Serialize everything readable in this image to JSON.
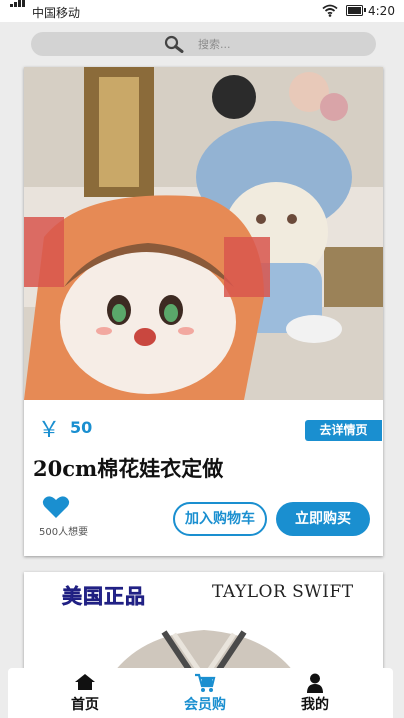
{
  "status_bar": {
    "carrier": "中国移动",
    "time": "4:20"
  },
  "search": {
    "placeholder": "搜索..."
  },
  "product": {
    "currency": "￥",
    "price": "50",
    "detail_label": "去详情页",
    "title": "20cm棉花娃衣定做",
    "wants": "500人想要",
    "add_cart_label": "加入购物车",
    "buy_now_label": "立即购买"
  },
  "product2": {
    "brand_left": "美国正品",
    "brand_right": "TAYLOR SWIFT"
  },
  "tabbar": {
    "items": [
      {
        "label": "首页",
        "icon": "home-icon"
      },
      {
        "label": "会员购",
        "icon": "cart-icon",
        "active": true
      },
      {
        "label": "我的",
        "icon": "user-icon"
      }
    ]
  },
  "colors": {
    "accent": "#1a8fd0",
    "background": "#ececec"
  }
}
